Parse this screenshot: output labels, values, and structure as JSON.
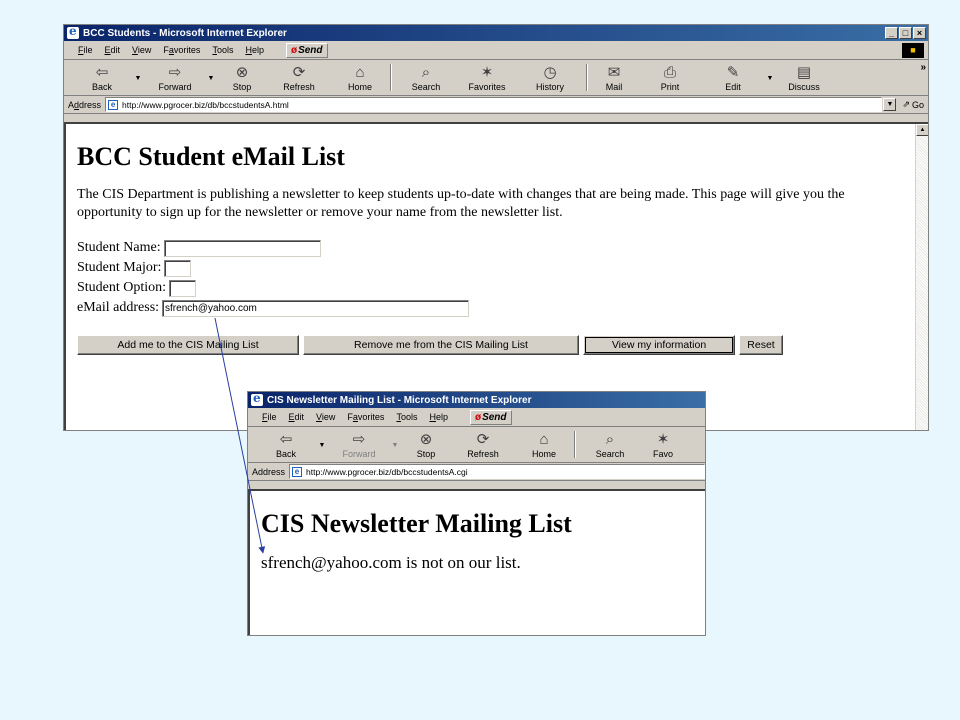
{
  "win1": {
    "title": "BCC Students - Microsoft Internet Explorer",
    "menu": [
      {
        "u": "F",
        "rest": "ile"
      },
      {
        "u": "E",
        "rest": "dit"
      },
      {
        "u": "V",
        "rest": "iew"
      },
      {
        "pre": "F",
        "u": "a",
        "rest": "vorites"
      },
      {
        "u": "T",
        "rest": "ools"
      },
      {
        "u": "H",
        "rest": "elp"
      }
    ],
    "send_label": "Send",
    "toolbar": {
      "back": "Back",
      "forward": "Forward",
      "stop": "Stop",
      "refresh": "Refresh",
      "home": "Home",
      "search": "Search",
      "favorites": "Favorites",
      "history": "History",
      "mail": "Mail",
      "print": "Print",
      "edit": "Edit",
      "discuss": "Discuss"
    },
    "address_label_u": "d",
    "address_label_pre": "A",
    "address_label_rest": "dress",
    "url": "http://www.pgrocer.biz/db/bccstudentsA.html",
    "go_label": "Go",
    "page": {
      "heading": "BCC Student eMail List",
      "intro": "The CIS Department is publishing a newsletter to keep students up-to-date with changes that are being made. This page will give you the opportunity to sign up for the newsletter or remove your name from the newsletter list.",
      "fields": {
        "name_label": "Student Name:",
        "name_value": "",
        "major_label": "Student Major:",
        "major_value": "",
        "option_label": "Student Option:",
        "option_value": "",
        "email_label": "eMail address:",
        "email_value": "sfrench@yahoo.com"
      },
      "buttons": {
        "add": "Add me to the CIS Mailing List",
        "remove": "Remove me from the CIS Mailing List",
        "view": "View my information",
        "reset": "Reset"
      }
    }
  },
  "win2": {
    "title": "CIS Newsletter Mailing List - Microsoft Internet Explorer",
    "send_label": "Send",
    "toolbar": {
      "back": "Back",
      "forward": "Forward",
      "stop": "Stop",
      "refresh": "Refresh",
      "home": "Home",
      "search": "Search",
      "favorites": "Favo"
    },
    "url": "http://www.pgrocer.biz/db/bccstudentsA.cgi",
    "page": {
      "heading": "CIS Newsletter Mailing List",
      "message": "sfrench@yahoo.com is not on our list."
    }
  },
  "common": {
    "address_label": "Address",
    "win_min": "_",
    "win_max": "□",
    "win_close": "×"
  }
}
